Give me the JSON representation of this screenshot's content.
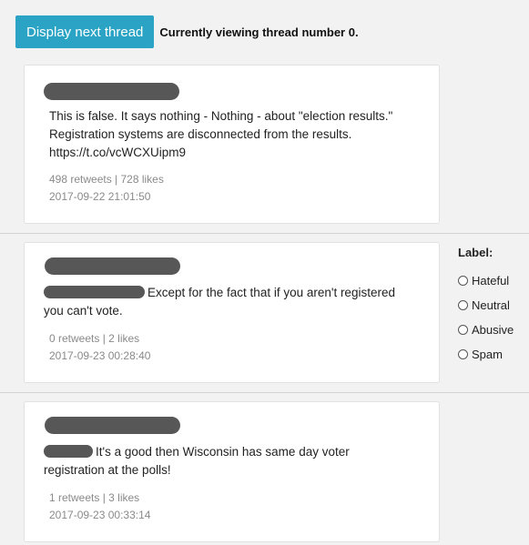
{
  "header": {
    "button_label": "Display next thread",
    "status_text": "Currently viewing thread number 0."
  },
  "tweets": [
    {
      "text": "This is false. It says nothing - Nothing - about \"election results.\" Registration systems are disconnected from the results. https://t.co/vcWCXUipm9",
      "stats": "498 retweets | 728 likes",
      "timestamp": "2017-09-22 21:01:50"
    },
    {
      "text": "Except for the fact that if you aren't registered you can't vote.",
      "stats": "0 retweets | 2 likes",
      "timestamp": "2017-09-23 00:28:40"
    },
    {
      "text": "It's a good then Wisconsin has same day voter registration at the polls!",
      "stats": "1 retweets | 3 likes",
      "timestamp": "2017-09-23 00:33:14"
    }
  ],
  "label_panel": {
    "title": "Label:",
    "options": [
      "Hateful",
      "Neutral",
      "Abusive",
      "Spam"
    ]
  }
}
